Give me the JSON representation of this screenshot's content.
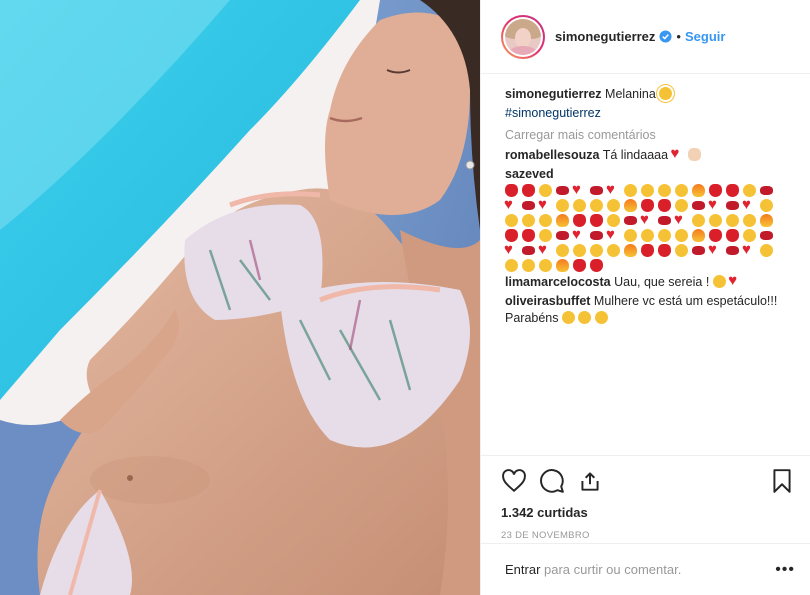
{
  "post": {
    "username": "simonegutierrez",
    "follow_label": "Seguir",
    "separator": "•"
  },
  "caption": {
    "username": "simonegutierrez",
    "text": "Melanina",
    "hashtag": "#simonegutierrez",
    "emoji": "sun"
  },
  "load_more_label": "Carregar mais comentários",
  "comments": [
    {
      "username": "romabellesouza",
      "text": "Tá lindaaaa",
      "emoji": [
        "heart",
        "hand"
      ]
    },
    {
      "username": "sazeved",
      "text": "",
      "emoji_count": 86
    },
    {
      "username": "limamarcelocosta",
      "text": "Uau, que sereia !",
      "emoji": [
        "face",
        "heart"
      ]
    },
    {
      "username": "oliveirasbuffet",
      "text": "Mulhere vc está um espetáculo!!! Parabéns",
      "emoji": [
        "face",
        "face",
        "face"
      ]
    }
  ],
  "likes": "1.342 curtidas",
  "date": "23 DE NOVEMBRO",
  "add_comment": {
    "link": "Entrar",
    "text": " para curtir ou comentar."
  },
  "options_label": "•••",
  "icons": [
    "heart-icon",
    "comment-icon",
    "share-icon",
    "bookmark-icon",
    "verified-icon"
  ],
  "colors": {
    "link": "#3897f0",
    "hashtag": "#003569",
    "muted": "#999999"
  }
}
